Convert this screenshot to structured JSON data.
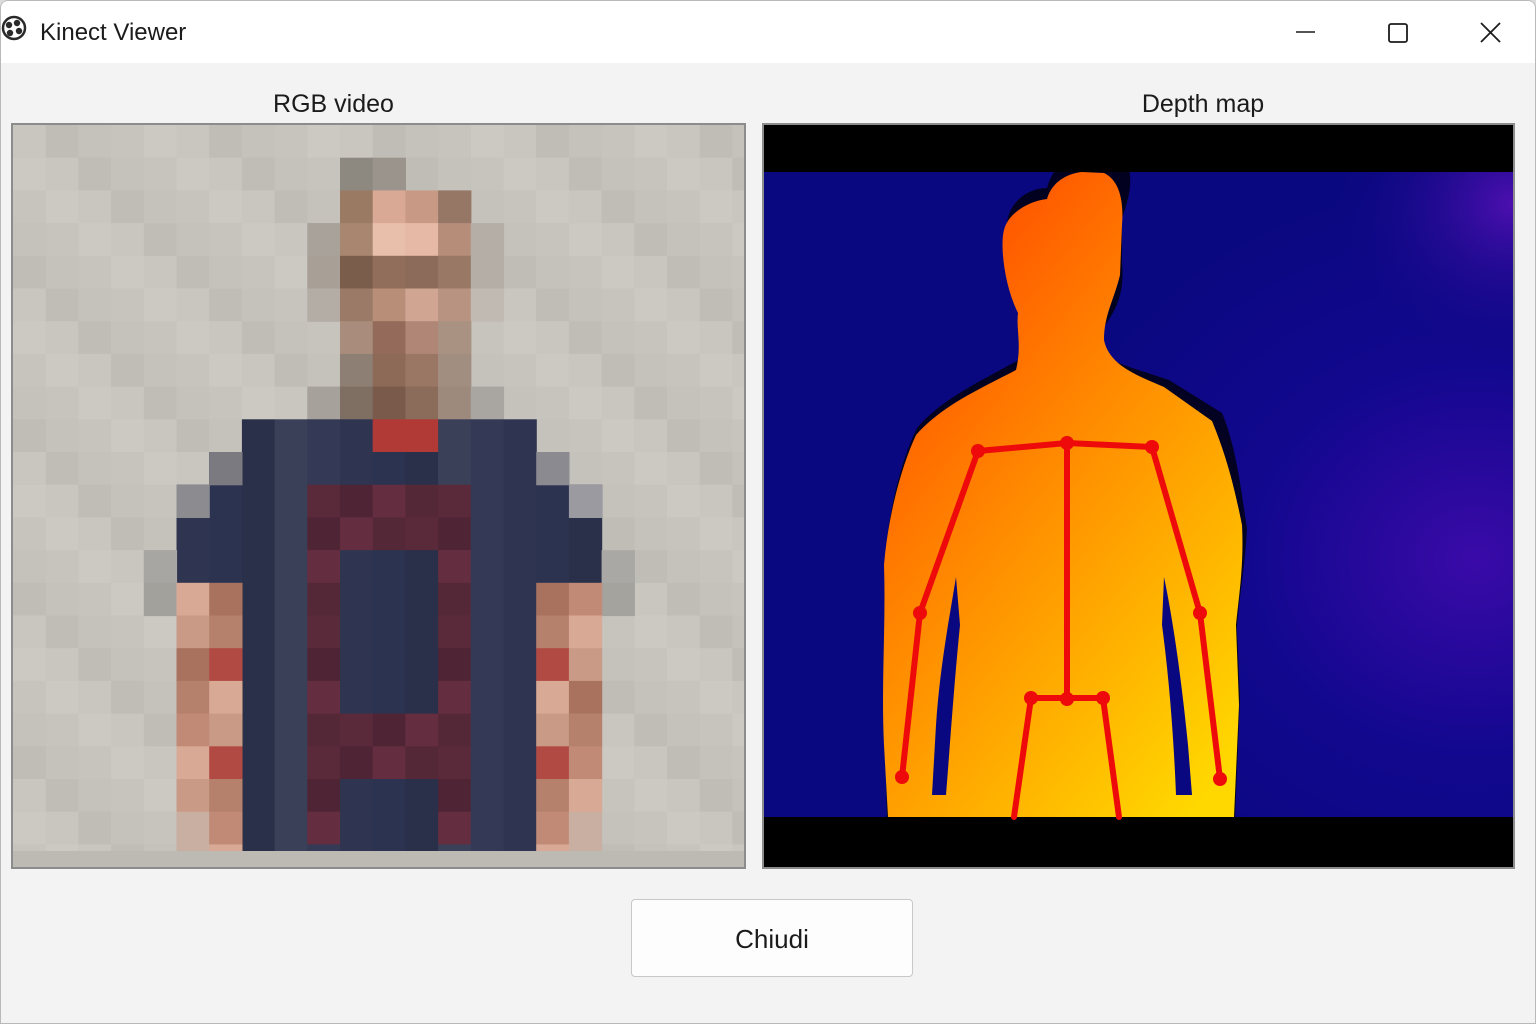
{
  "window": {
    "title": "Kinect Viewer",
    "app_icon": "kinect-app-icon",
    "controls": {
      "minimize_icon": "minimize-icon",
      "maximize_icon": "maximize-icon",
      "close_icon": "close-icon"
    }
  },
  "panels": {
    "rgb": {
      "label": "RGB video",
      "content": "pixelated-person-image"
    },
    "depth": {
      "label": "Depth map",
      "content": "depth-silhouette-with-skeleton",
      "colors": {
        "background": "#0a0a86",
        "near": "#ff4a00",
        "far": "#ffd400",
        "skeleton": "#ee0a0a",
        "letterbox": "#000000"
      }
    }
  },
  "footer": {
    "close_button_label": "Chiudi"
  }
}
